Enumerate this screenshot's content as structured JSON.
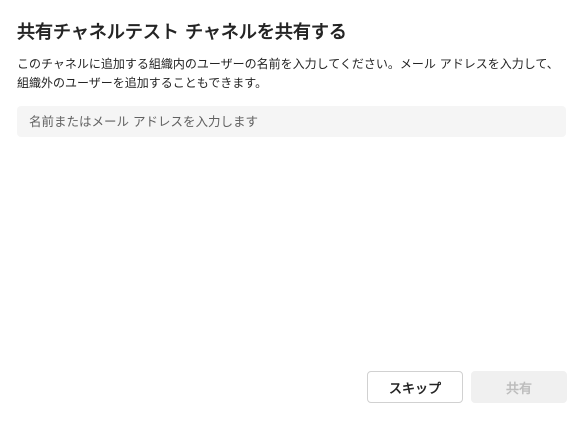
{
  "dialog": {
    "title": "共有チャネルテスト チャネルを共有する",
    "description": "このチャネルに追加する組織内のユーザーの名前を入力してください。メール アドレスを入力して、組織外のユーザーを追加することもできます。",
    "search": {
      "placeholder": "名前またはメール アドレスを入力します",
      "value": ""
    },
    "buttons": {
      "skip_label": "スキップ",
      "share_label": "共有"
    }
  },
  "colors": {
    "text": "#242424",
    "input_background": "#f5f5f5",
    "disabled_button_background": "#f0f0f0",
    "disabled_button_text": "#bdbdbd",
    "button_border": "#d1d1d1"
  }
}
